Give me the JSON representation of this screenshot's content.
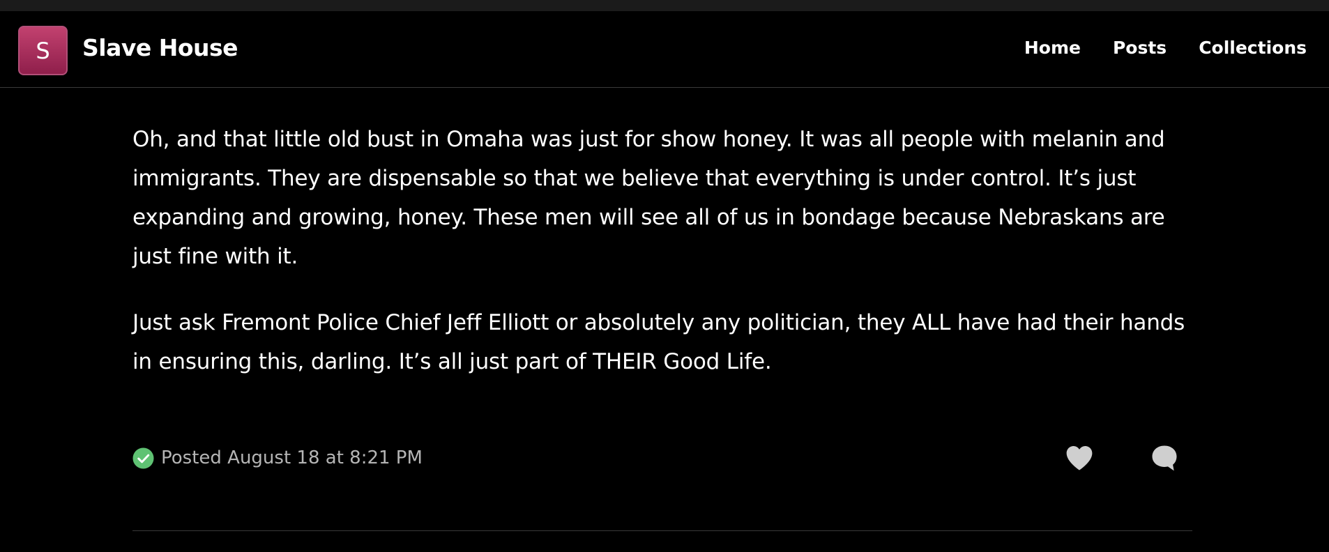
{
  "header": {
    "logo_letter": "S",
    "site_title": "Slave House",
    "nav": [
      {
        "label": "Home"
      },
      {
        "label": "Posts"
      },
      {
        "label": "Collections"
      }
    ]
  },
  "post": {
    "paragraphs": [
      "Oh, and that little old bust in Omaha was just for show honey. It was all people with melanin and immigrants. They are dispensable so that we believe that everything is under control. It’s just expanding and growing, honey. These men will see all of us in bondage because Nebraskans are just fine with it.",
      "Just ask Fremont Police Chief Jeff Elliott or absolutely any politician, they ALL have had their hands in ensuring this, darling. It’s all just part of THEIR Good Life."
    ],
    "posted_text": "Posted August 18 at 8:21 PM",
    "icons": {
      "status": "check-circle-icon",
      "like": "heart-icon",
      "comment": "comment-bubble-icon"
    }
  },
  "colors": {
    "background": "#000000",
    "logo_accent": "#b0305f",
    "check_green": "#5fc273",
    "muted_text": "#b5b5b5",
    "icon_gray": "#cfcfcf"
  }
}
